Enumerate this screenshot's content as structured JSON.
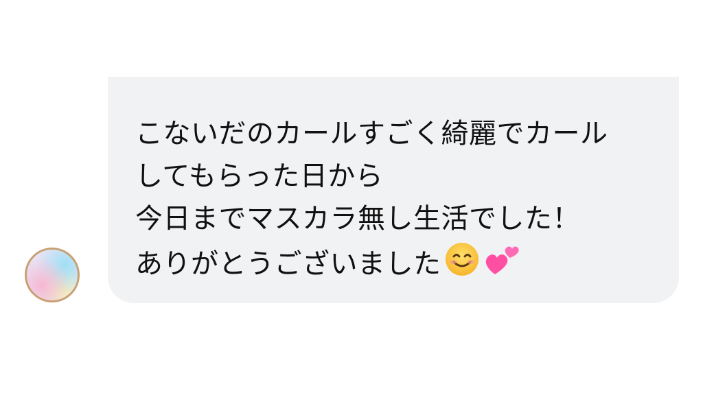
{
  "message": {
    "lines": [
      "こないだのカールすごく綺麗でカール",
      "してもらった日から",
      "今日までマスカラ無し生活でした！",
      "ありがとうございました"
    ],
    "emojis": [
      "smiling-face-icon",
      "two-hearts-icon"
    ]
  },
  "colors": {
    "bubble_background": "#f1f2f4",
    "text": "#111111",
    "avatar_ring": "#c9a074"
  }
}
